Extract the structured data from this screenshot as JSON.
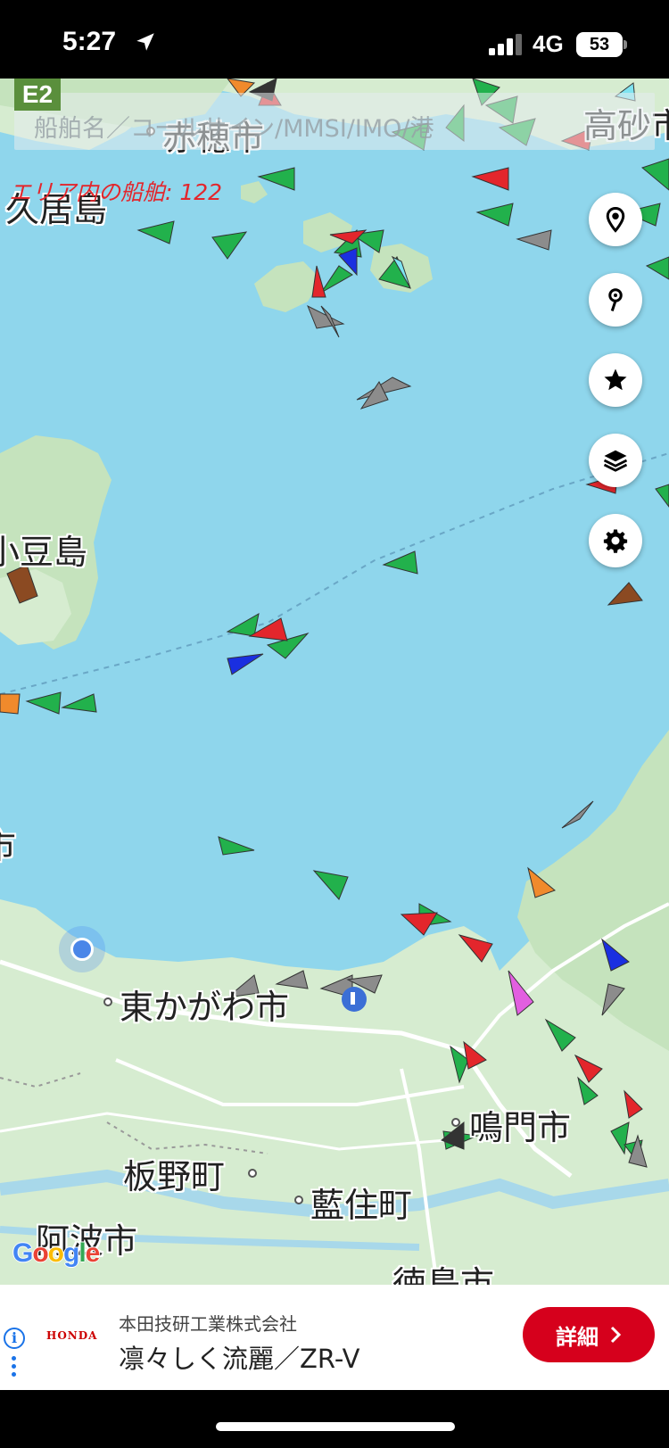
{
  "status_bar": {
    "time": "5:27",
    "network": "4G",
    "battery": "53"
  },
  "map": {
    "zone_badge": "E2",
    "search_placeholder": "船舶名／コールサイン/MMSI/IMO/港",
    "vessel_count": "エリア内の船舶: 122",
    "places": {
      "ako": "赤穂市",
      "takasago": "高砂市",
      "ieshima": "久居島",
      "shodoshima": "小豆島",
      "higashikagawa": "東かがわ市",
      "naruto": "鳴門市",
      "itano": "板野町",
      "aizumi": "藍住町",
      "awa": "阿波市",
      "tokushima": "徳島市",
      "left_edge": "市"
    },
    "buttons": {
      "location": "map-pin-icon",
      "pin": "drop-pin-icon",
      "favorites": "star-icon",
      "layers": "layers-icon",
      "settings": "gear-icon"
    },
    "attribution": "Google",
    "ship_colors": {
      "cargo": "#22b14c",
      "tanker": "#e3262c",
      "passenger": "#1a2fe0",
      "unknown": "#8c8c8c",
      "fishing": "#f08a2c",
      "tug": "#8b4a22",
      "pleasure": "#e25fe0",
      "high_speed": "#7ee3f0"
    }
  },
  "ad": {
    "logo": "HONDA",
    "company": "本田技研工業株式会社",
    "title": "凛々しく流麗／ZR-V",
    "button": "詳細"
  }
}
